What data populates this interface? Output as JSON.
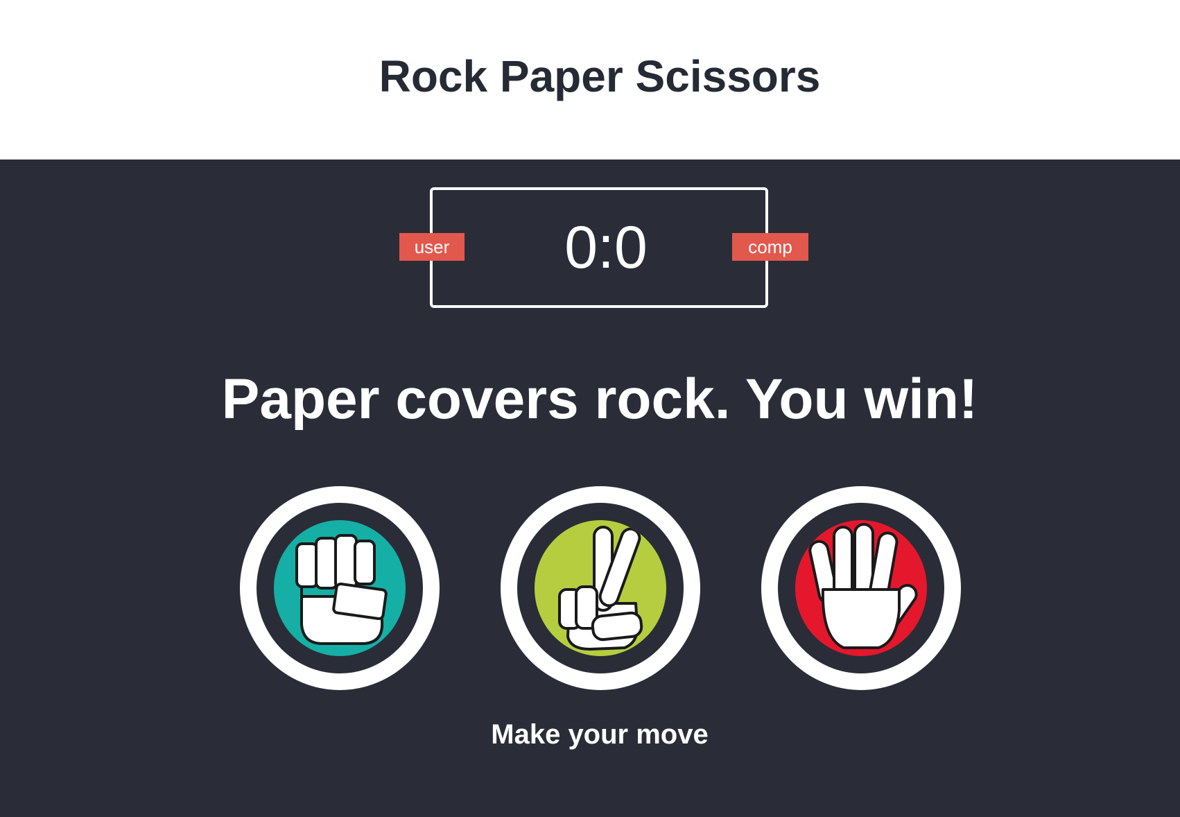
{
  "app": {
    "title": "Rock Paper Scissors"
  },
  "scoreboard": {
    "user_label": "user",
    "comp_label": "comp",
    "score": "0:0",
    "accent_color": "#e2584d"
  },
  "result": {
    "message": "Paper covers rock. You win!"
  },
  "choices": [
    {
      "id": "r",
      "move": "rock",
      "icon": "fist-icon",
      "color": "#15afa5"
    },
    {
      "id": "s",
      "move": "scissors",
      "icon": "peace-hand-icon",
      "color": "#b5cd3f"
    },
    {
      "id": "p",
      "move": "paper",
      "icon": "open-hand-icon",
      "color": "#e5172d"
    }
  ],
  "action_message": "Make your move",
  "colors": {
    "background": "#2a2d37",
    "header": "#ffffff",
    "text_dark": "#252a34"
  }
}
